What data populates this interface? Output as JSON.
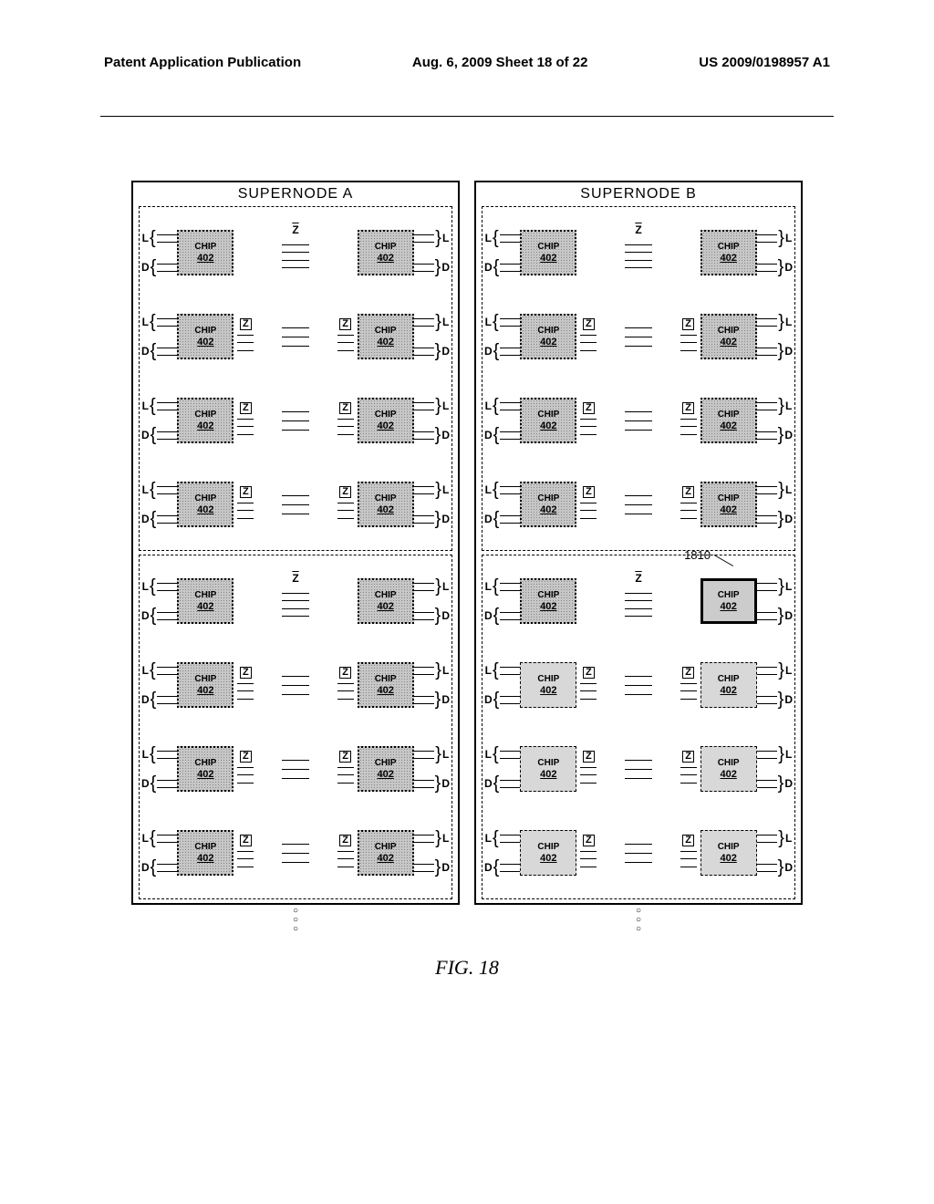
{
  "header": {
    "left": "Patent Application Publication",
    "center": "Aug. 6, 2009  Sheet 18 of 22",
    "right": "US 2009/0198957 A1"
  },
  "supernodes": {
    "a": {
      "title": "SUPERNODE A"
    },
    "b": {
      "title": "SUPERNODE B"
    }
  },
  "labels": {
    "chip": "CHIP",
    "ref": "402",
    "L": "L",
    "D": "D",
    "Z": "Z",
    "callout_ref": "1810"
  },
  "figure": "FIG. 18",
  "chart_data": {
    "type": "block-diagram",
    "description": "Two supernodes (A and B), each containing two vertical groups of 4 rows; each row has two CHIP 402 blocks connected by Z buses in the middle and L/D buses on the outer edges. Rows are interconnected. In Supernode B's lower group, the right-column chips and one top-row chip are highlighted; callout 1810 points to the top-right highlighted chip.",
    "supernodes": [
      {
        "name": "SUPERNODE A",
        "books": [
          {
            "rows": 4,
            "chips_per_row": 2,
            "chip_label": "CHIP",
            "chip_ref": "402",
            "side_buses": [
              "L",
              "D"
            ],
            "center_bus": "Z"
          },
          {
            "rows": 4,
            "chips_per_row": 2,
            "chip_label": "CHIP",
            "chip_ref": "402",
            "side_buses": [
              "L",
              "D"
            ],
            "center_bus": "Z"
          }
        ]
      },
      {
        "name": "SUPERNODE B",
        "books": [
          {
            "rows": 4,
            "chips_per_row": 2,
            "chip_label": "CHIP",
            "chip_ref": "402",
            "side_buses": [
              "L",
              "D"
            ],
            "center_bus": "Z"
          },
          {
            "rows": 4,
            "chips_per_row": 2,
            "chip_label": "CHIP",
            "chip_ref": "402",
            "side_buses": [
              "L",
              "D"
            ],
            "center_bus": "Z",
            "highlighted": {
              "callout": "1810",
              "positions": [
                "row0-right",
                "row1-left",
                "row1-right",
                "row2-left",
                "row2-right",
                "row3-left",
                "row3-right"
              ]
            }
          }
        ]
      }
    ],
    "continuation_dots_below_each_supernode": true
  }
}
